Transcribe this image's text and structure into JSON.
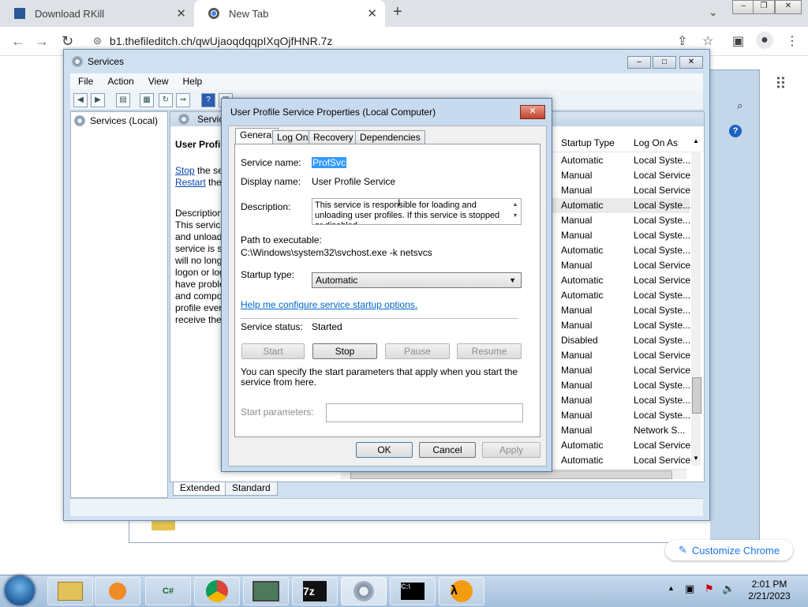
{
  "browser": {
    "tabs": [
      {
        "label": "Download RKill"
      },
      {
        "label": "New Tab"
      }
    ],
    "url": "b1.thefileditch.ch/qwUjaoqdqqpIXqOjfHNR.7z"
  },
  "services_window": {
    "title": "Services",
    "menu": [
      "File",
      "Action",
      "View",
      "Help"
    ],
    "tree_item": "Services (Local)",
    "pane_header": "Servic",
    "detail_title": "User Profil",
    "stop_link": "Stop",
    "stop_rest": " the ser",
    "restart_link": "Restart",
    "restart_rest": " the",
    "desc_lines": [
      "Description",
      "This service",
      "and unload",
      "service is st",
      "will no long",
      "logon or log",
      "have proble",
      "and compo",
      "profile ever",
      "receive ther"
    ],
    "columns": [
      "Startup Type",
      "Log On As"
    ],
    "rows": [
      [
        "Automatic",
        "Local Syste..."
      ],
      [
        "Manual",
        "Local Service"
      ],
      [
        "Manual",
        "Local Service"
      ],
      [
        "Automatic",
        "Local Syste..."
      ],
      [
        "Manual",
        "Local Syste..."
      ],
      [
        "Manual",
        "Local Syste..."
      ],
      [
        "Automatic",
        "Local Syste..."
      ],
      [
        "Manual",
        "Local Service"
      ],
      [
        "Automatic",
        "Local Service"
      ],
      [
        "Automatic",
        "Local Syste..."
      ],
      [
        "Manual",
        "Local Syste..."
      ],
      [
        "Manual",
        "Local Syste..."
      ],
      [
        "Disabled",
        "Local Syste..."
      ],
      [
        "Manual",
        "Local Service"
      ],
      [
        "Manual",
        "Local Service"
      ],
      [
        "Manual",
        "Local Syste..."
      ],
      [
        "Manual",
        "Local Syste..."
      ],
      [
        "Manual",
        "Local Syste..."
      ],
      [
        "Manual",
        "Network S..."
      ],
      [
        "Automatic",
        "Local Service"
      ],
      [
        "Automatic",
        "Local Service"
      ]
    ],
    "bottom_tabs": [
      "Extended",
      "Standard"
    ]
  },
  "dialog": {
    "title": "User Profile Service Properties (Local Computer)",
    "tabs": [
      "General",
      "Log On",
      "Recovery",
      "Dependencies"
    ],
    "service_name_label": "Service name:",
    "service_name": "ProfSvc",
    "display_name_label": "Display name:",
    "display_name": "User Profile Service",
    "description_label": "Description:",
    "description": "This service is responsible for loading and unloading user profiles. If this service is stopped or disabled,",
    "path_label": "Path to executable:",
    "path": "C:\\Windows\\system32\\svchost.exe -k netsvcs",
    "startup_type_label": "Startup type:",
    "startup_type": "Automatic",
    "help_link": "Help me configure service startup options.",
    "status_label": "Service status:",
    "status": "Started",
    "btn_start": "Start",
    "btn_stop": "Stop",
    "btn_pause": "Pause",
    "btn_resume": "Resume",
    "params_text": "You can specify the start parameters that apply when you start the service from here.",
    "params_label": "Start parameters:",
    "ok": "OK",
    "cancel": "Cancel",
    "apply": "Apply"
  },
  "customize": "Customize Chrome",
  "taskbar": {
    "time": "2:01 PM",
    "date": "2/21/2023",
    "app_cs": "C#",
    "app_7z": "7z"
  }
}
